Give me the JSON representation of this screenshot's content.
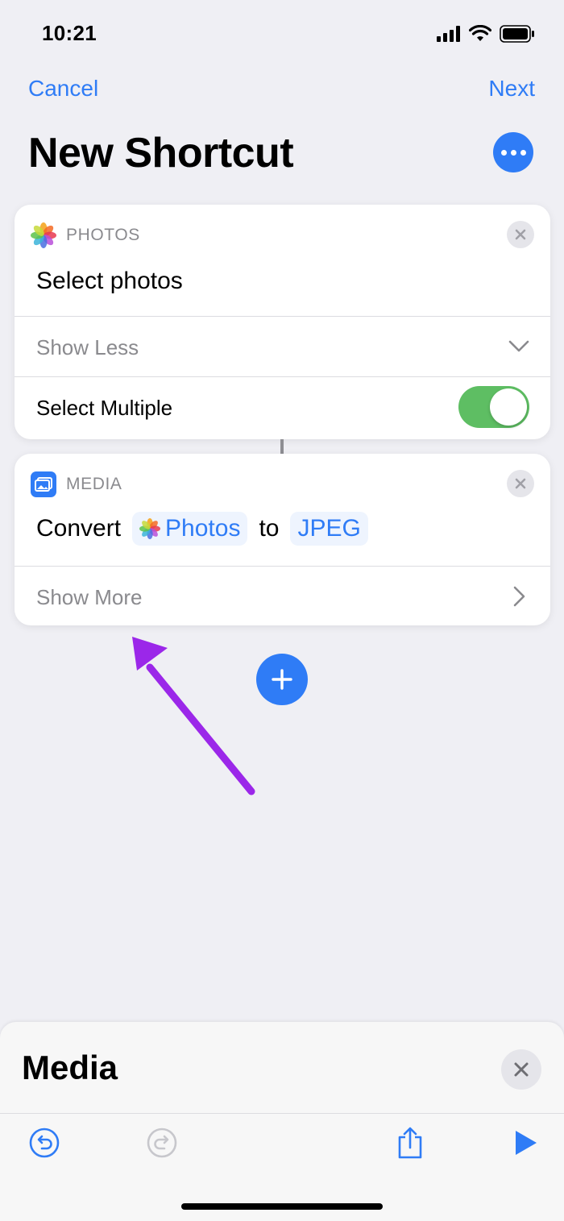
{
  "status_bar": {
    "time": "10:21"
  },
  "nav": {
    "cancel_label": "Cancel",
    "next_label": "Next"
  },
  "page": {
    "title": "New Shortcut"
  },
  "cards": [
    {
      "app": "PHOTOS",
      "icon": "photos-icon",
      "action_title": "Select photos",
      "toggle_row_label": "Show Less",
      "option_label": "Select Multiple",
      "option_enabled": true
    },
    {
      "app": "MEDIA",
      "icon": "media-icon",
      "action_word": "Convert",
      "input_token": "Photos",
      "connector_word": "to",
      "format_token": "JPEG",
      "toggle_row_label": "Show More"
    }
  ],
  "sheet": {
    "title": "Media"
  },
  "colors": {
    "accent": "#2f7cf6",
    "toggle_on": "#5ebe63",
    "annotation_arrow": "#9b27e9"
  }
}
